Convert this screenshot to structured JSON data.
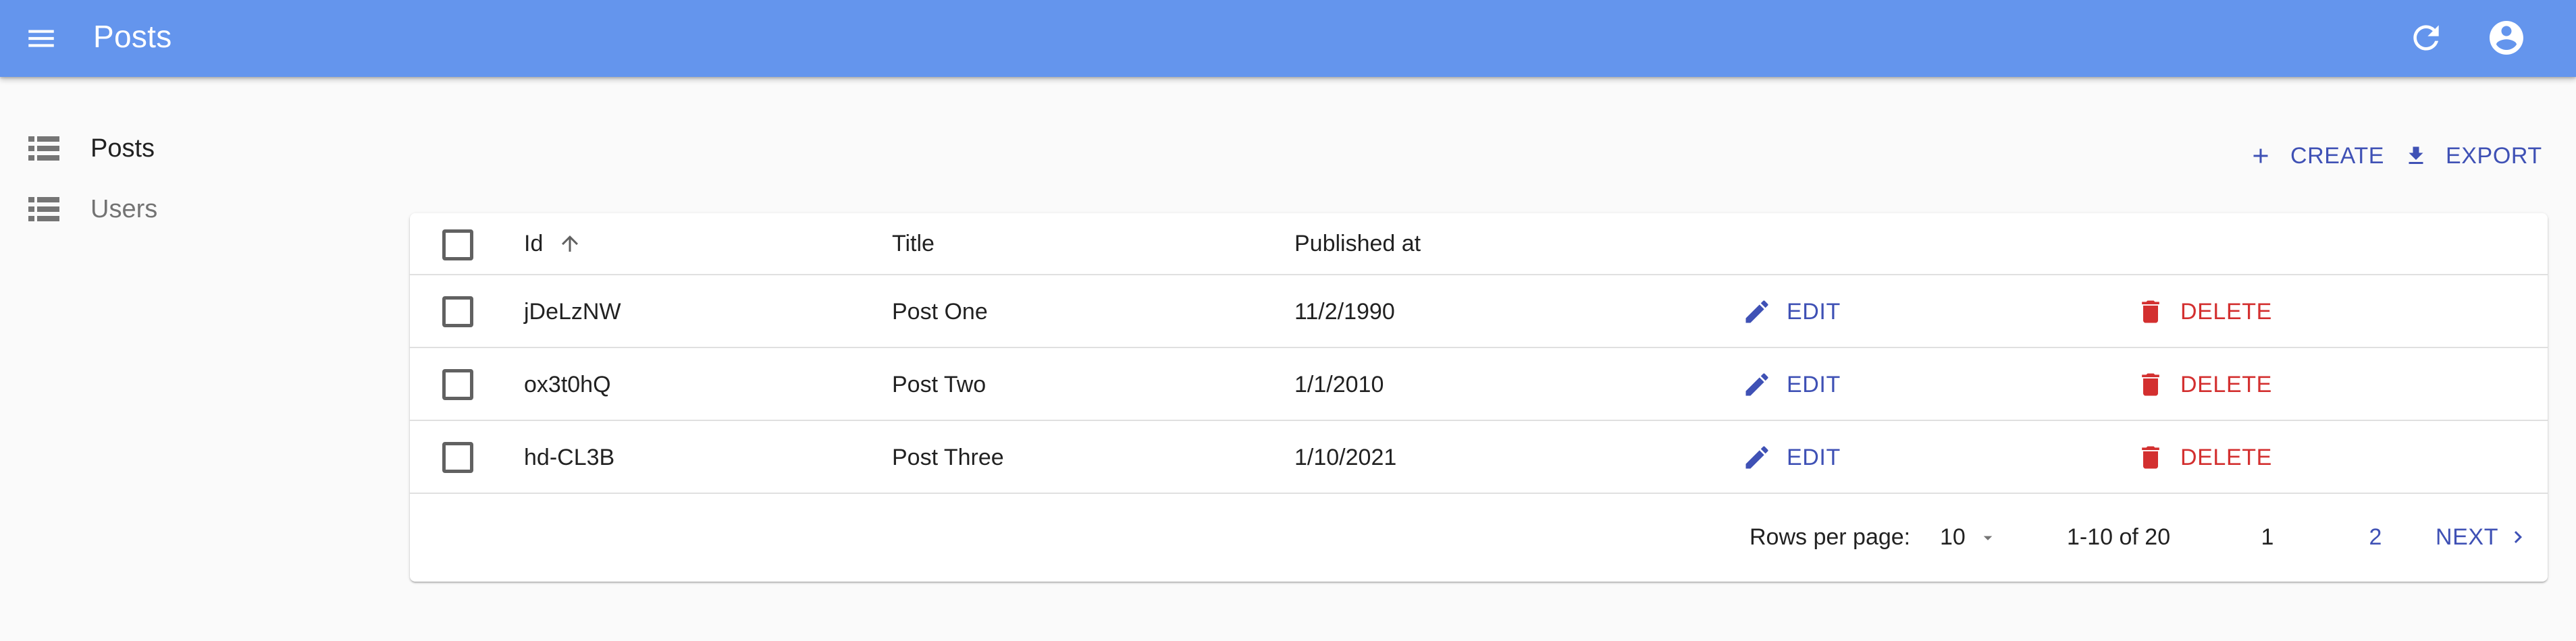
{
  "app": {
    "title": "Posts"
  },
  "colors": {
    "appbar": "#6495ed",
    "primary": "#3f51b5",
    "danger": "#d32f2f"
  },
  "sidebar": {
    "items": [
      {
        "label": "Posts",
        "icon": "list-icon",
        "active": true
      },
      {
        "label": "Users",
        "icon": "list-icon",
        "active": false
      }
    ]
  },
  "toolbar": {
    "create_label": "CREATE",
    "export_label": "EXPORT"
  },
  "table": {
    "columns": {
      "id": "Id",
      "title": "Title",
      "published": "Published at"
    },
    "sort": {
      "column": "Id",
      "direction": "ascending"
    },
    "edit_label": "EDIT",
    "delete_label": "DELETE",
    "rows": [
      {
        "id": "jDeLzNW",
        "title": "Post One",
        "published": "11/2/1990"
      },
      {
        "id": "ox3t0hQ",
        "title": "Post Two",
        "published": "1/1/2010"
      },
      {
        "id": "hd-CL3B",
        "title": "Post Three",
        "published": "1/10/2021"
      }
    ]
  },
  "pagination": {
    "rows_per_page_label": "Rows per page:",
    "rows_per_page_value": "10",
    "range": "1-10 of 20",
    "pages": [
      "1",
      "2"
    ],
    "current_page": "1",
    "next_label": "NEXT"
  }
}
